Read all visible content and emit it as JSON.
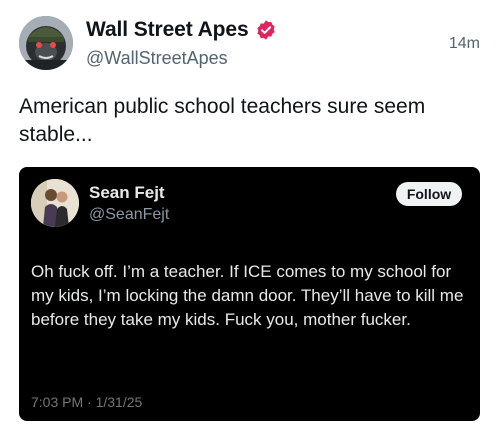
{
  "post": {
    "author_name": "Wall Street Apes",
    "author_handle": "@WallStreetApes",
    "timestamp": "14m",
    "text": "American public school teachers sure seem stable...",
    "verified_color": "#e0245e"
  },
  "quoted_post": {
    "author_name": "Sean Fejt",
    "author_handle": "@SeanFejt",
    "follow_label": "Follow",
    "text": "Oh fuck off. I’m a teacher. If ICE comes to my school for my kids, I’m locking the damn door. They’ll have to kill me before they take my kids. Fuck you, mother fucker.",
    "timestamp": "7:03 PM · 1/31/25"
  },
  "icons": {
    "avatar": "gorilla-avatar",
    "verified": "verified-badge-icon",
    "quoted_avatar": "couple-photo-avatar"
  }
}
